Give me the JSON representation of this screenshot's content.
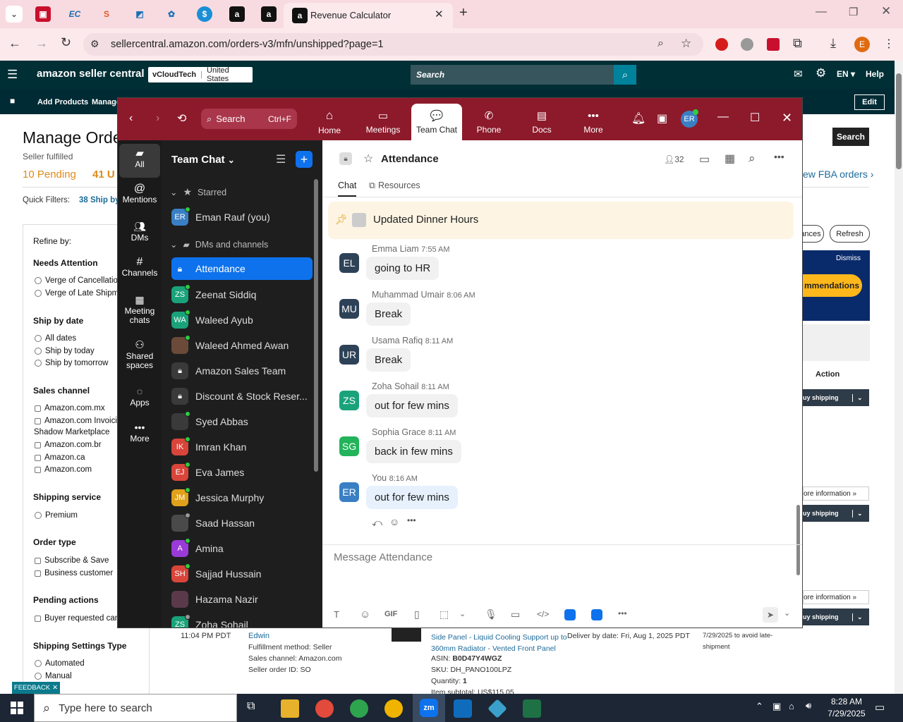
{
  "browser": {
    "active_tab_title": "Revenue Calculator",
    "url": "sellercentral.amazon.com/orders-v3/mfn/unshipped?page=1",
    "profile_initial": "E"
  },
  "amazon": {
    "logo": "amazon seller central",
    "store_name": "vCloudTech",
    "marketplace": "United States",
    "search_placeholder": "Search",
    "language": "EN",
    "help": "Help",
    "nav_add_products": "Add Products",
    "nav_manage": "Manage",
    "edit": "Edit",
    "page_title": "Manage Orde",
    "subtitle": "Seller fulfilled",
    "pending": "10 Pending",
    "unshipped": "41 U",
    "quick_filters_label": "Quick Filters:",
    "quick_filter_1": "38 Ship by",
    "search_button": "Search",
    "fba_link": "ew FBA orders ›",
    "ances_button": "ances",
    "refresh_button": "Refresh",
    "dismiss": "Dismiss",
    "banner_button": "mmendations",
    "action_header": "Action",
    "buy_shipping": "uy shipping",
    "more_information": "ore information »",
    "refine": {
      "title": "Refine by:",
      "sections": [
        {
          "title": "Needs Attention",
          "options": [
            "Verge of Cancellatio",
            "Verge of Late Shipm"
          ]
        },
        {
          "title": "Ship by date",
          "options": [
            "All dates",
            "Ship by today",
            "Ship by tomorrow"
          ]
        },
        {
          "title": "Sales channel",
          "options": [
            "Amazon.com.mx",
            "Amazon.com Invoici",
            "Shadow Marketplace",
            "Amazon.com.br",
            "Amazon.ca",
            "Amazon.com"
          ]
        },
        {
          "title": "Shipping service",
          "options": [
            "Premium"
          ]
        },
        {
          "title": "Order type",
          "options": [
            "Subscribe & Save",
            "Business customer"
          ]
        },
        {
          "title": "Pending actions",
          "options": [
            "Buyer requested can"
          ]
        },
        {
          "title": "Shipping Settings Type",
          "options": [
            "Automated",
            "Manual"
          ]
        }
      ]
    },
    "order": {
      "time": "11:04 PM PDT",
      "buyer": "Edwin",
      "fulfillment": "Fulfillment method: Seller",
      "sales_channel": "Sales channel: Amazon.com",
      "seller_order_id": "Seller order ID: SO",
      "product_line1": "Side Panel - Liquid Cooling Support up to",
      "product_line2": "360mm Radiator - Vented Front Panel",
      "asin": "B0D47Y4WGZ",
      "sku": "DH_PANO100LPZ",
      "quantity": "1",
      "item_subtotal": "Item subtotal: US$115.05",
      "deliver_by": "Deliver by date: Fri, Aug 1, 2025 PDT",
      "ship_note_1": "7/29/2025 to avoid late-",
      "ship_note_2": "shipment"
    },
    "feedback": "FEEDBACK"
  },
  "zoom": {
    "search_label": "Search",
    "search_shortcut": "Ctrl+F",
    "nav": [
      "Home",
      "Meetings",
      "Team Chat",
      "Phone",
      "Docs",
      "More"
    ],
    "user_initials": "ER",
    "rail": [
      {
        "label": "All"
      },
      {
        "label": "Mentions"
      },
      {
        "label": "DMs"
      },
      {
        "label": "Channels"
      },
      {
        "label": "Meeting chats"
      },
      {
        "label": "Shared spaces"
      },
      {
        "label": "Apps"
      },
      {
        "label": "More"
      }
    ],
    "sidebar_title": "Team Chat",
    "starred_label": "Starred",
    "dms_label": "DMs and channels",
    "contacts": [
      {
        "name": "Eman Rauf (you)",
        "initials": "ER",
        "color": "#3a7fc4"
      },
      {
        "name": "Attendance",
        "initials": "",
        "color": ""
      },
      {
        "name": "Zeenat Siddiq",
        "initials": "ZS",
        "color": "#1aa37a"
      },
      {
        "name": "Waleed Ayub",
        "initials": "WA",
        "color": "#1aa37a"
      },
      {
        "name": "Waleed Ahmed Awan",
        "initials": "",
        "color": "#6b4a3a"
      },
      {
        "name": "Amazon Sales Team",
        "initials": "",
        "color": ""
      },
      {
        "name": "Discount & Stock Reser...",
        "initials": "",
        "color": ""
      },
      {
        "name": "Syed Abbas",
        "initials": "",
        "color": "#3a3a3a"
      },
      {
        "name": "Imran Khan",
        "initials": "IK",
        "color": "#d9453a"
      },
      {
        "name": "Eva James",
        "initials": "EJ",
        "color": "#d9453a"
      },
      {
        "name": "Jessica Murphy",
        "initials": "JM",
        "color": "#e0a11a"
      },
      {
        "name": "Saad Hassan",
        "initials": "",
        "color": "#4a4a4a"
      },
      {
        "name": "Amina",
        "initials": "A",
        "color": "#9a3ad9"
      },
      {
        "name": "Sajjad Hussain",
        "initials": "SH",
        "color": "#d9453a"
      },
      {
        "name": "Hazama Nazir",
        "initials": "",
        "color": "#5a3a4a"
      },
      {
        "name": "Zoha Sohail",
        "initials": "ZS",
        "color": "#1aa37a"
      }
    ],
    "channel": {
      "name": "Attendance",
      "member_count": "32",
      "tab_chat": "Chat",
      "tab_resources": "Resources",
      "pinned": "Updated Dinner Hours"
    },
    "messages": [
      {
        "sender": "Emma Liam",
        "time": "7:55 AM",
        "initials": "EL",
        "color": "#2d4257",
        "text": "going to HR"
      },
      {
        "sender": "Muhammad Umair",
        "time": "8:06 AM",
        "initials": "MU",
        "color": "#2d4257",
        "text": "Break"
      },
      {
        "sender": "Usama Rafiq",
        "time": "8:11 AM",
        "initials": "UR",
        "color": "#2d4257",
        "text": "Break"
      },
      {
        "sender": "Zoha Sohail",
        "time": "8:11 AM",
        "initials": "ZS",
        "color": "#1aa37a",
        "text": "out for few mins"
      },
      {
        "sender": "Sophia Grace",
        "time": "8:11 AM",
        "initials": "SG",
        "color": "#23b35a",
        "text": "back in few mins"
      },
      {
        "sender": "You",
        "time": "8:16 AM",
        "initials": "ER",
        "color": "#3a7fc4",
        "text": "out for few mins"
      }
    ],
    "composer_placeholder": "Message Attendance"
  },
  "taskbar": {
    "search_placeholder": "Type here to search",
    "time": "8:28 AM",
    "date": "7/29/2025"
  }
}
